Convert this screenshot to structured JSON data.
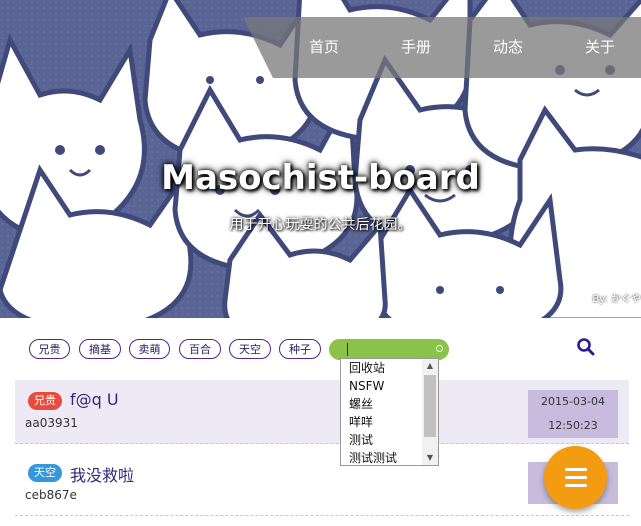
{
  "nav": {
    "items": [
      {
        "label": "首页"
      },
      {
        "label": "手册"
      },
      {
        "label": "动态"
      },
      {
        "label": "关于"
      }
    ]
  },
  "hero": {
    "title": "Masochist-board",
    "subtitle": "用于开心玩耍的公共后花园。",
    "credit": "By: かぐや"
  },
  "tags": [
    {
      "label": "兄贵"
    },
    {
      "label": "摘基"
    },
    {
      "label": "卖萌"
    },
    {
      "label": "百合"
    },
    {
      "label": "天空"
    },
    {
      "label": "种子"
    }
  ],
  "tag_input": {
    "value": "",
    "dropdown_options": [
      "回收站",
      "NSFW",
      "螺丝",
      "咩咩",
      "测试",
      "测试测试"
    ]
  },
  "posts": [
    {
      "badge": "兄贵",
      "badge_color": "#e74c3c",
      "title": "f@q U",
      "author": "aa03931",
      "date": "2015-03-04",
      "time": "12:50:23"
    },
    {
      "badge": "天空",
      "badge_color": "#3498db",
      "title": "我没救啦",
      "author": "ceb867e",
      "date": "",
      "time": ""
    }
  ],
  "colors": {
    "accent": "#4b2a8f",
    "tag_input_bg": "#8bc34a",
    "fab": "#f39c12",
    "hero_bg": "#5a6596"
  },
  "icons": {
    "search": "search-icon",
    "menu": "menu-icon"
  }
}
